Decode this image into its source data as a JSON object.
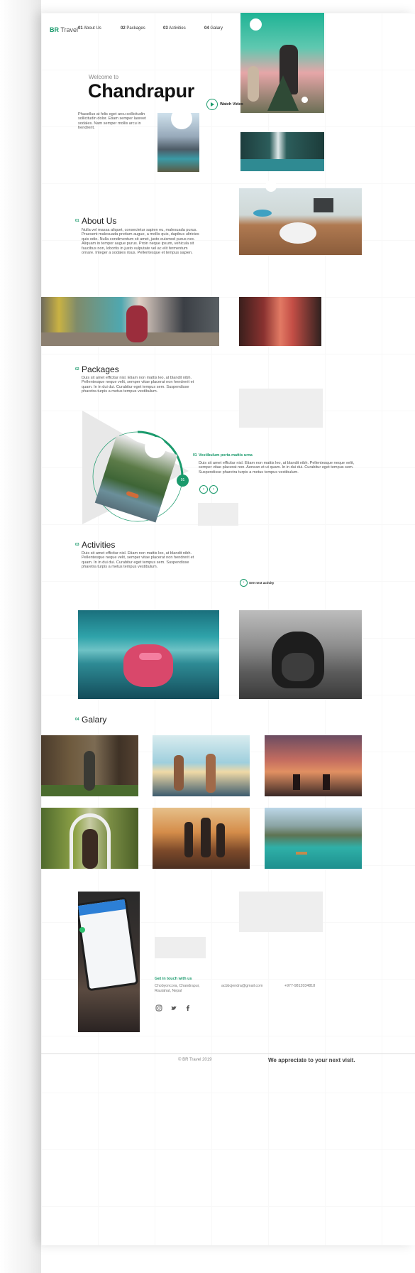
{
  "brand": {
    "mark": "BR",
    "name": "Travel"
  },
  "nav": [
    {
      "num": "01",
      "label": "About Us"
    },
    {
      "num": "02",
      "label": "Packages"
    },
    {
      "num": "03",
      "label": "Activities"
    },
    {
      "num": "04",
      "label": "Galary"
    }
  ],
  "hero": {
    "welcome": "Welcome to",
    "city": "Chandrapur",
    "watch_label": "Watch Video",
    "text": "Phasellus at felis eget arcu sollicitudin sollicitudin dolor. Etiam semper laoreet sodales. Nam semper mollis arcu in hendrerit."
  },
  "about": {
    "num": "01",
    "title": "About Us",
    "text": "Nulla vel massa aliquet, consectetur sapien eu, malesuada purus. Praesent malesuada pretium augue, a mollis quis, dapibus ultricies quis odio. Nulla condimentum sit amet, justo euismod purus nec. Aliquam in tempor augue purus. Proin neque ipsum, vehicula sit faucibus non, lobortis in justo vulputate vel ac elit fermentum ornare. Integer a sodales risus. Pellentesque et tempus sapien."
  },
  "packages": {
    "num": "02",
    "title": "Packages",
    "text": "Duis sit amet efficitur nisl. Etiam non mattis leo, at blandit nibh. Pellentesque neque velit, semper vitae placerat non hendrerit et quam. In in dui dui. Curabitur eget tempus sem. Suspendisse pharetra turpis a metus tempus vestibulum.",
    "badge": "01",
    "card_num": "01",
    "card_title": "Vestibulum porta mattis urna",
    "card_text": "Duis sit amet efficitur nisl. Etiam non mattis leo, at blandit nibh. Pellentesque neque velit, semper vitae placerat non. Aenean et ut quam. In in dui dui. Curabitur eget tempus sem. Suspendisse pharetra turpis a metus tempus vestibulum.",
    "prev": "‹",
    "next": "›"
  },
  "activities": {
    "num": "03",
    "title": "Activities",
    "text": "Duis sit amet efficitur nisl. Etiam non mattis leo, at blandit nibh. Pellentesque neque velit, semper vitae placerat non hendrerit et quam. In in dui dui. Curabitur eget tempus sem. Suspendisse pharetra turpis a metus tempus vestibulum.",
    "see_next": "See next activity"
  },
  "gallery": {
    "num": "04",
    "title": "Galary"
  },
  "contact": {
    "title": "Get in touch with us",
    "address": "Chobyoncora, Chandrapur, Rautahat, Nepal",
    "email": "acbbcjendra@gmail.com",
    "phone": "+977-9812034818"
  },
  "social_icons": [
    "instagram-icon",
    "twitter-icon",
    "facebook-icon"
  ],
  "footer": {
    "copyright": "© BR Travel 2019",
    "tagline": "We appreciate to your next visit."
  },
  "colors": {
    "accent": "#1a9a6c"
  }
}
